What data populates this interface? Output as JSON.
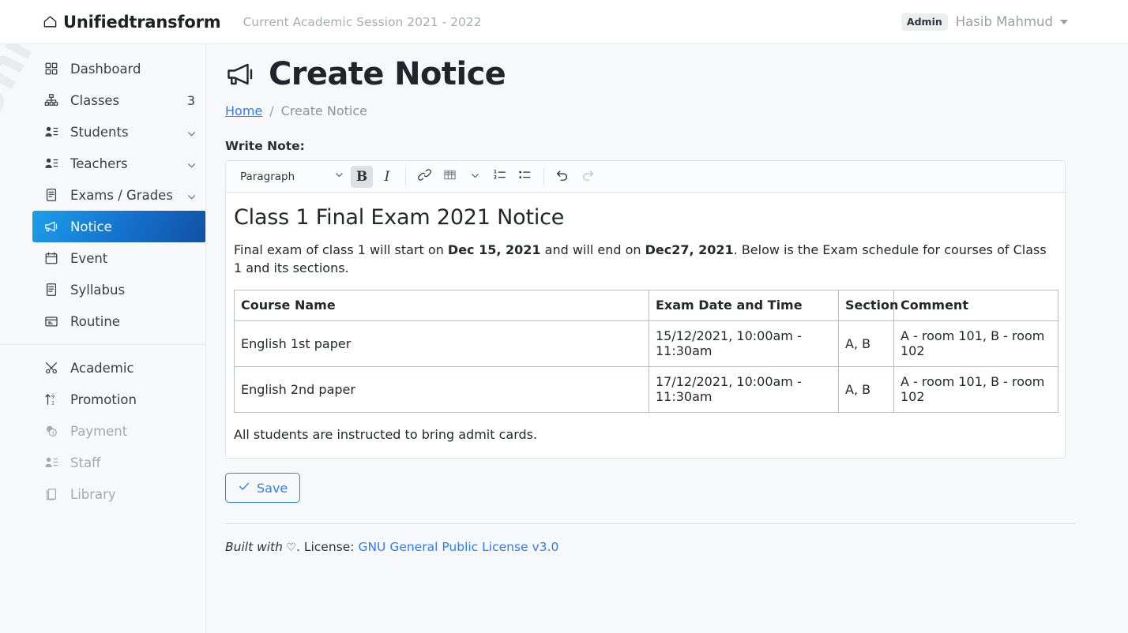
{
  "navbar": {
    "brand": "Unifiedtransform",
    "brand_icon": "home-icon",
    "session": "Current Academic Session 2021 - 2022",
    "role_badge": "Admin",
    "user_name": "Hasib Mahmud",
    "caret_icon": "caret-down-icon"
  },
  "sidebar": {
    "watermark": "Unifiedtransform",
    "items": [
      {
        "label": "Dashboard",
        "icon": "grid-icon",
        "count": "",
        "chevron": false,
        "active": false,
        "muted": false
      },
      {
        "label": "Classes",
        "icon": "sitemap-icon",
        "count": "3",
        "chevron": false,
        "active": false,
        "muted": false
      },
      {
        "label": "Students",
        "icon": "users-icon",
        "count": "",
        "chevron": true,
        "active": false,
        "muted": false
      },
      {
        "label": "Teachers",
        "icon": "users-icon",
        "count": "",
        "chevron": true,
        "active": false,
        "muted": false
      },
      {
        "label": "Exams / Grades",
        "icon": "document-icon",
        "count": "",
        "chevron": true,
        "active": false,
        "muted": false
      },
      {
        "label": "Notice",
        "icon": "megaphone-icon",
        "count": "",
        "chevron": false,
        "active": true,
        "muted": false
      },
      {
        "label": "Event",
        "icon": "calendar-icon",
        "count": "",
        "chevron": false,
        "active": false,
        "muted": false
      },
      {
        "label": "Syllabus",
        "icon": "list-doc-icon",
        "count": "",
        "chevron": false,
        "active": false,
        "muted": false
      },
      {
        "label": "Routine",
        "icon": "routine-icon",
        "count": "",
        "chevron": false,
        "active": false,
        "muted": false
      },
      {
        "label": "Academic",
        "icon": "tools-icon",
        "count": "",
        "chevron": false,
        "active": false,
        "muted": false
      },
      {
        "label": "Promotion",
        "icon": "promote-icon",
        "count": "",
        "chevron": false,
        "active": false,
        "muted": false
      },
      {
        "label": "Payment",
        "icon": "coins-icon",
        "count": "",
        "chevron": false,
        "active": false,
        "muted": true
      },
      {
        "label": "Staff",
        "icon": "users-icon",
        "count": "",
        "chevron": false,
        "active": false,
        "muted": true
      },
      {
        "label": "Library",
        "icon": "books-icon",
        "count": "",
        "chevron": false,
        "active": false,
        "muted": true
      }
    ],
    "divider_after_index": 8
  },
  "page": {
    "title": "Create Notice",
    "title_icon": "megaphone-icon",
    "breadcrumb_home": "Home",
    "breadcrumb_sep": "/",
    "breadcrumb_current": "Create Notice",
    "field_label": "Write Note:"
  },
  "toolbar": {
    "block_format": "Paragraph",
    "block_format_caret": "chevron-down-icon",
    "bold_label": "B",
    "italic_label": "I",
    "link_icon": "link-icon",
    "table_icon": "table-icon",
    "table_caret": "chevron-down-icon",
    "ordered_list_icon": "ordered-list-icon",
    "bullet_list_icon": "bullet-list-icon",
    "undo_icon": "undo-icon",
    "redo_icon": "redo-icon"
  },
  "note": {
    "title": "Class 1 Final Exam 2021 Notice",
    "para_part1": "Final exam of class 1 will start on ",
    "para_bold1": "Dec 15, 2021",
    "para_part2": " and will end on ",
    "para_bold2": "Dec27, 2021",
    "para_part3": ". Below is the Exam schedule for courses of Class 1 and its sections.",
    "table": {
      "headers": [
        "Course Name",
        "Exam Date and Time",
        "Section",
        "Comment"
      ],
      "rows": [
        [
          "English 1st paper",
          "15/12/2021, 10:00am - 11:30am",
          "A, B",
          "A - room 101, B - room 102"
        ],
        [
          "English 2nd paper",
          "17/12/2021, 10:00am - 11:30am",
          "A, B",
          "A - room 101, B - room 102"
        ]
      ]
    },
    "closing": "All students are instructed to bring admit cards."
  },
  "actions": {
    "save_label": "Save",
    "save_icon": "check-icon"
  },
  "footer": {
    "built_with": "Built with",
    "heart_icon": "heart-icon",
    "license_prefix": ". License: ",
    "license_link": "GNU General Public License v3.0"
  },
  "colors": {
    "accent_blue": "#2f7df6",
    "active_gradient_from": "#1c9fe8",
    "active_gradient_to": "#1150a6",
    "page_bg": "#f7f8fa",
    "text": "#23272b",
    "muted_text": "#a4a9af"
  }
}
